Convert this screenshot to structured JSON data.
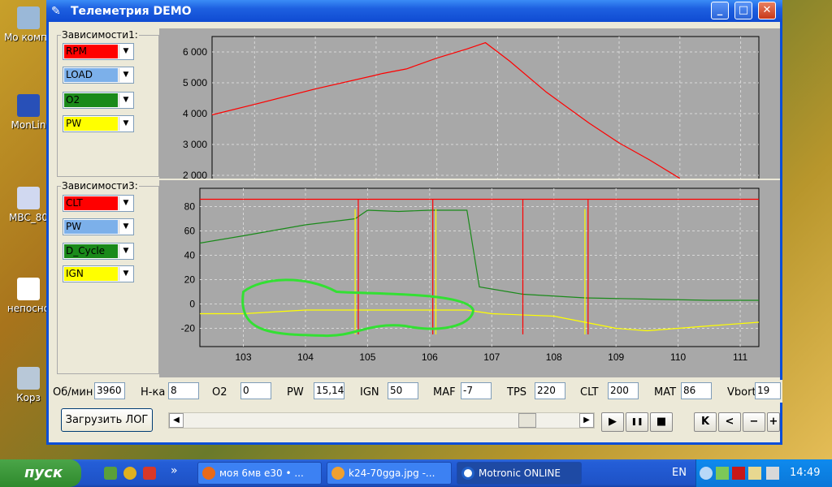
{
  "desktop": {
    "icons": [
      {
        "label": "Мо компь"
      },
      {
        "label": "MonLin"
      },
      {
        "label": "MBC_80"
      },
      {
        "label": "непосно"
      },
      {
        "label": "Корз"
      }
    ]
  },
  "window": {
    "title": "Телеметрия DEMO",
    "minimize": "_",
    "maximize": "□",
    "close": "✕"
  },
  "group1": {
    "label": "Зависимости1:",
    "combos": [
      {
        "value": "RPM",
        "color": "#ff0000"
      },
      {
        "value": "LOAD",
        "color": "#7cb0ea"
      },
      {
        "value": "O2",
        "color": "#1a8a1a"
      },
      {
        "value": "PW",
        "color": "#ffff00"
      }
    ]
  },
  "group3": {
    "label": "Зависимости3:",
    "combos": [
      {
        "value": "CLT",
        "color": "#ff0000"
      },
      {
        "value": "PW",
        "color": "#7cb0ea"
      },
      {
        "value": "D_Cycle",
        "color": "#1a8a1a"
      },
      {
        "value": "IGN",
        "color": "#ffff00"
      }
    ]
  },
  "chart_data": [
    {
      "type": "line",
      "y_ticks": [
        "6 000",
        "5 000",
        "4 000",
        "3 000",
        "2 000"
      ],
      "ylim": [
        1500,
        6500
      ],
      "grid": true,
      "series": [
        {
          "name": "RPM",
          "color": "#ff0000",
          "x": [
            102.3,
            103.0,
            104.0,
            105.0,
            105.1,
            105.5,
            106.0,
            106.5,
            106.8,
            107.2,
            107.8,
            108.5,
            109.0,
            109.5,
            110.0
          ],
          "y": [
            3960,
            4300,
            4800,
            5250,
            5300,
            5450,
            5800,
            6100,
            6300,
            5700,
            4700,
            3700,
            3050,
            2500,
            1900
          ]
        }
      ]
    },
    {
      "type": "line",
      "x_ticks": [
        "103",
        "104",
        "105",
        "106",
        "107",
        "108",
        "109",
        "110",
        "111"
      ],
      "y_ticks": [
        "80",
        "60",
        "40",
        "20",
        "0",
        "-20"
      ],
      "xlim": [
        102.3,
        111.3
      ],
      "ylim": [
        -35,
        95
      ],
      "grid": true,
      "series": [
        {
          "name": "CLT",
          "color": "#ff0000",
          "x": [
            102.3,
            111.3
          ],
          "y": [
            86,
            86
          ]
        },
        {
          "name": "D_Cycle",
          "color": "#1a8a1a",
          "x": [
            102.3,
            103.0,
            104.0,
            104.8,
            105.0,
            105.5,
            106.0,
            106.6,
            106.8,
            107.5,
            108.5,
            109.5,
            110.5,
            111.3
          ],
          "y": [
            50,
            56,
            65,
            70,
            77,
            76,
            77,
            77,
            14,
            8,
            5,
            4,
            3,
            3
          ]
        },
        {
          "name": "IGN",
          "color": "#ffff00",
          "x": [
            102.3,
            103.0,
            104.0,
            104.8,
            105.5,
            106.6,
            107.0,
            108.0,
            108.5,
            109.0,
            109.5,
            110.5,
            111.3
          ],
          "y": [
            -8,
            -8,
            -5,
            -5,
            -5,
            -5,
            -8,
            -10,
            -15,
            -20,
            -22,
            -18,
            -15
          ]
        }
      ]
    }
  ],
  "stats": [
    {
      "label": "Об/мин",
      "value": "3960"
    },
    {
      "label": "Н-ка",
      "value": "8"
    },
    {
      "label": "О2",
      "value": "0"
    },
    {
      "label": "PW",
      "value": "15,14"
    },
    {
      "label": "IGN",
      "value": "50"
    },
    {
      "label": "MAF",
      "value": "-7"
    },
    {
      "label": "TPS",
      "value": "220"
    },
    {
      "label": "CLT",
      "value": "200"
    },
    {
      "label": "MAT",
      "value": "86"
    },
    {
      "label": "Vbort",
      "value": "19"
    }
  ],
  "controls": {
    "load_label": "Загрузить ЛОГ",
    "scroll_left": "◀",
    "scroll_right": "▶",
    "play": "▶",
    "pause": "❚❚",
    "stop": "■",
    "first": "K",
    "prev": "<",
    "minus": "−",
    "plus": "+"
  },
  "taskbar": {
    "start_label": "пуск",
    "more": "»",
    "tasks": [
      {
        "label": "моя 6мв е30 • ..."
      },
      {
        "label": "k24-70gga.jpg -..."
      },
      {
        "label": "Motronic ONLINE"
      }
    ],
    "lang": "EN",
    "clock": "14:49"
  }
}
